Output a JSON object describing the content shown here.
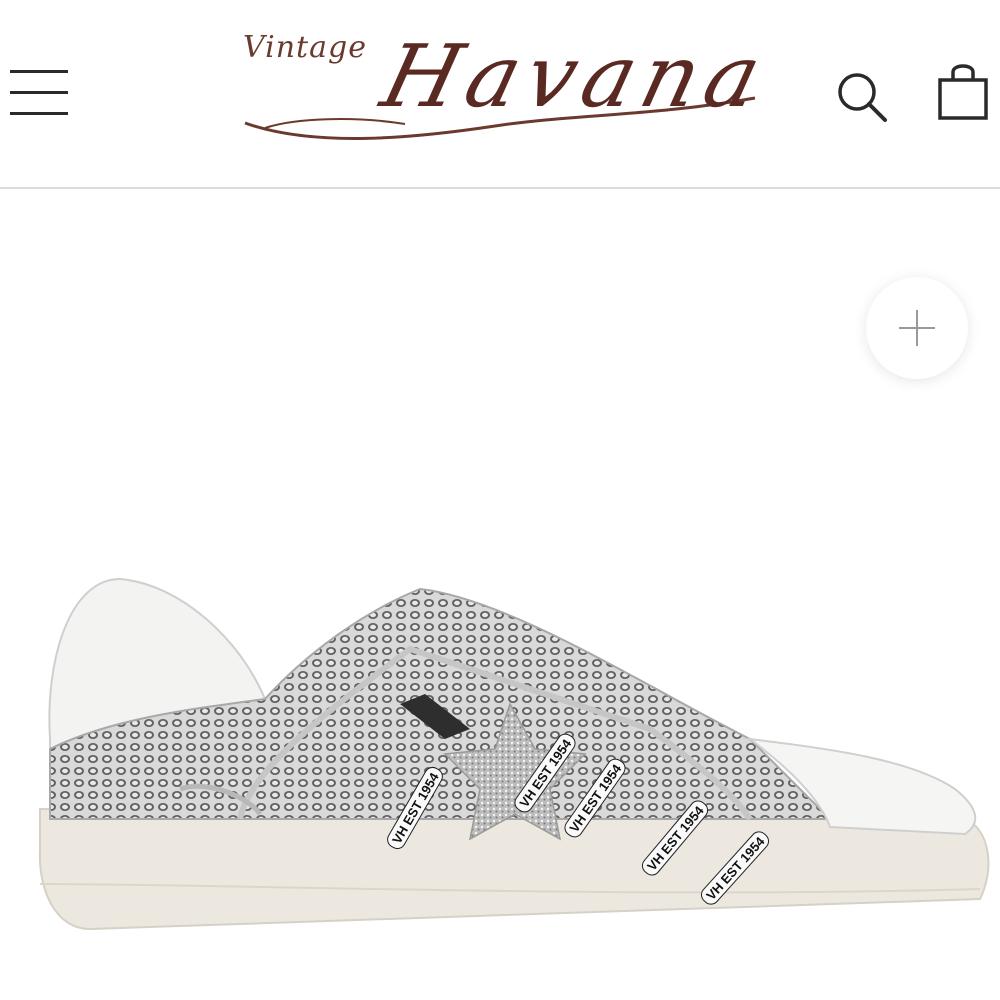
{
  "header": {
    "logo_small": "Vintage",
    "logo_big": "Havana",
    "menu_icon": "hamburger-menu-icon",
    "search_icon": "search-icon",
    "cart_icon": "shopping-bag-icon"
  },
  "gallery": {
    "zoom_icon": "plus-icon",
    "lace_text": "VH EST 1954"
  },
  "colors": {
    "logo": "#5a2a22",
    "divider": "#dcdcdc",
    "icon": "#2a2a2a"
  }
}
